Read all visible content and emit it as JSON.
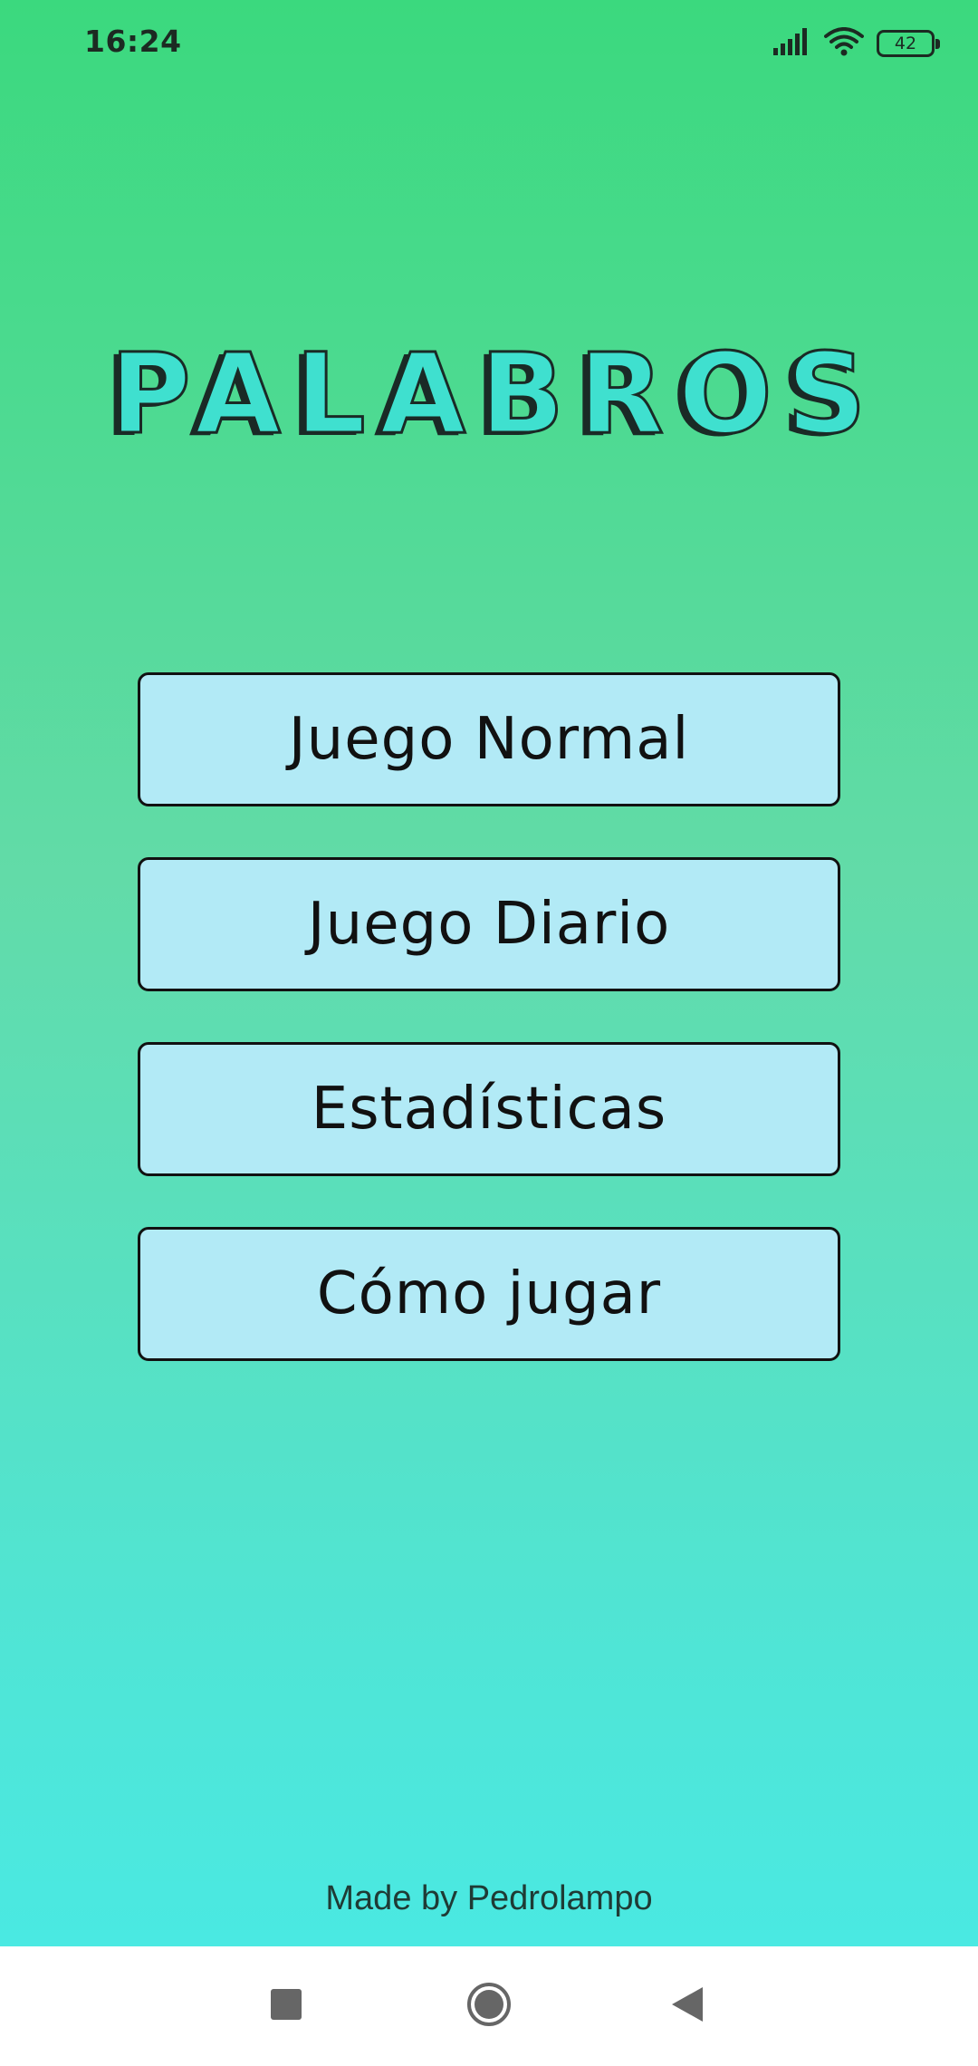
{
  "status_bar": {
    "time": "16:24",
    "battery_level": "42"
  },
  "app": {
    "title": "PALABROS",
    "colors": {
      "gradient_top": "#3bd97e",
      "gradient_bottom": "#4ae9e2",
      "title_fill": "#3fe0cf",
      "button_fill": "#b2eaf6"
    }
  },
  "menu": {
    "items": [
      {
        "label": "Juego Normal"
      },
      {
        "label": "Juego Diario"
      },
      {
        "label": "Estadísticas"
      },
      {
        "label": "Cómo jugar"
      }
    ]
  },
  "footer": {
    "credit": "Made by Pedrolampo"
  },
  "nav_bar": {
    "icons": [
      "recents-icon",
      "home-icon",
      "back-icon"
    ]
  }
}
